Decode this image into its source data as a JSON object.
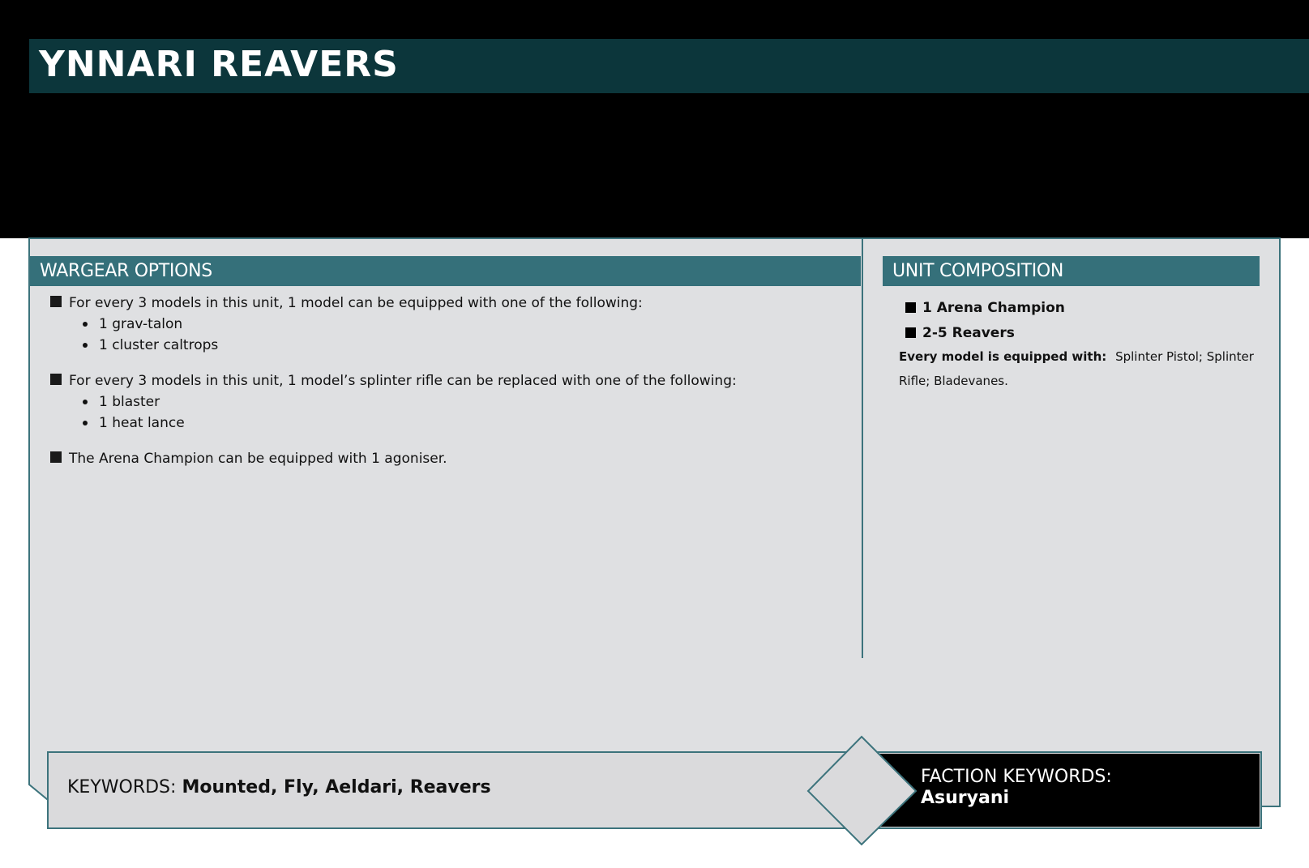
{
  "header": {
    "title": "YNNARI REAVERS"
  },
  "wargear": {
    "heading": "WARGEAR OPTIONS",
    "options": [
      {
        "text": "For every 3 models in this unit, 1 model can be equipped with one of the following:",
        "items": [
          "1 grav-talon",
          "1 cluster caltrops"
        ]
      },
      {
        "text": "For every 3 models in this unit, 1 model’s splinter rifle can be replaced with one of the following:",
        "items": [
          "1 blaster",
          "1 heat lance"
        ]
      },
      {
        "text": "The Arena Champion can be equipped with 1 agoniser.",
        "items": []
      }
    ]
  },
  "composition": {
    "heading": "UNIT COMPOSITION",
    "items": [
      "1 Arena Champion",
      "2-5 Reavers"
    ],
    "equipped_label": "Every model is equipped with:",
    "equipped_text": "Splinter Pistol; Splinter Rifle; Bladevanes."
  },
  "keywords": {
    "label": "KEYWORDS:",
    "values": "Mounted, Fly, Aeldari, Reavers"
  },
  "faction_keywords": {
    "label": "FACTION KEYWORDS:",
    "values": "Asuryani"
  },
  "colors": {
    "title_bar": "#0c363b",
    "section_header": "#35707a",
    "card_background": "#dfe0e2",
    "border": "#3c737c"
  }
}
